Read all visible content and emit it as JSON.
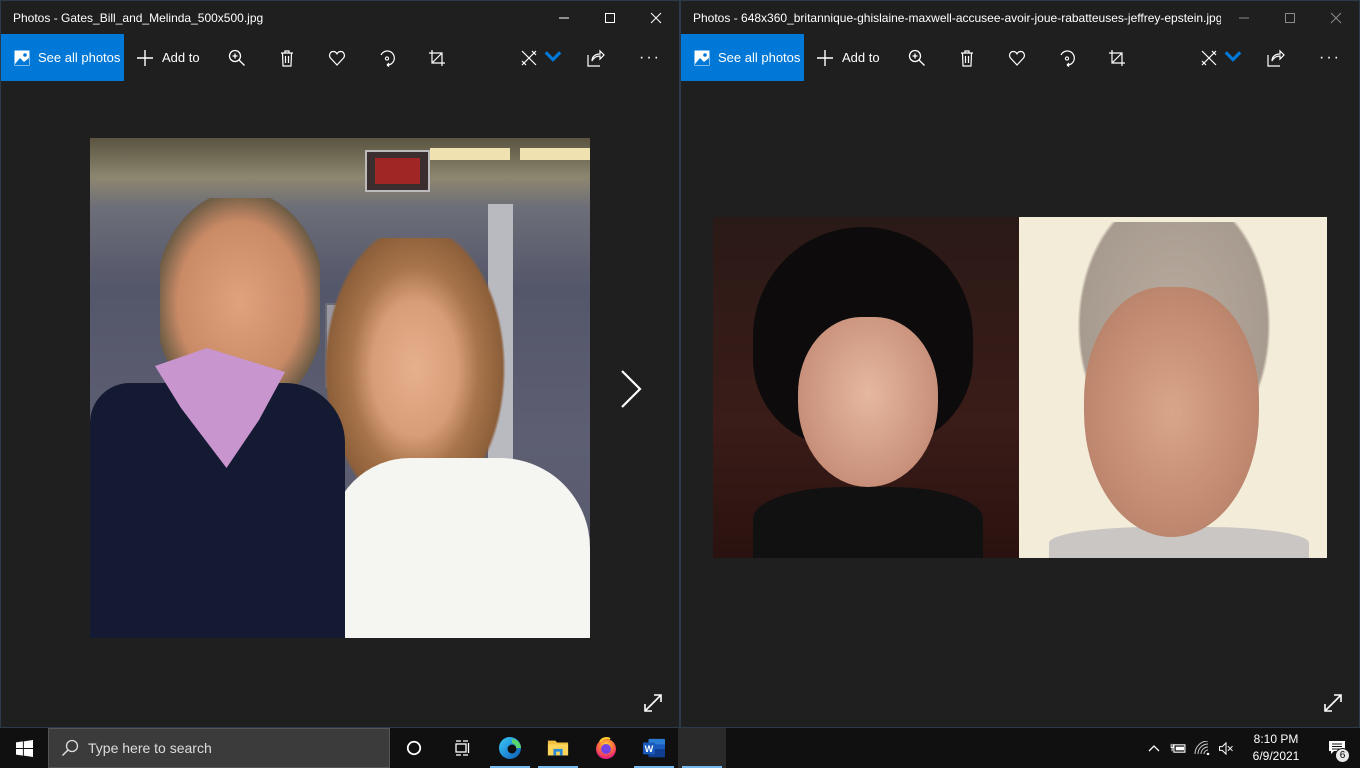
{
  "windows": [
    {
      "title": "Photos - Gates_Bill_and_Melinda_500x500.jpg",
      "image_description": "Bill and Melinda Gates smiling, indoors",
      "toolbar": {
        "see_all_label": "See all photos",
        "add_to_label": "Add to",
        "icons": [
          "zoom-in-icon",
          "delete-icon",
          "favorite-icon",
          "rotate-icon",
          "crop-icon",
          "edit-icon",
          "share-icon",
          "more-icon"
        ],
        "more_label": "···"
      },
      "controls": {
        "minimize": "minimize",
        "maximize": "maximize",
        "close": "close"
      }
    },
    {
      "title": "Photos - 648x360_britannique-ghislaine-maxwell-accusee-avoir-joue-rabatteuses-jeffrey-epstein.jpg",
      "image_description": "Side-by-side portraits of Ghislaine Maxwell and Jeffrey Epstein",
      "toolbar": {
        "see_all_label": "See all photos",
        "add_to_label": "Add to",
        "icons": [
          "zoom-in-icon",
          "delete-icon",
          "favorite-icon",
          "rotate-icon",
          "crop-icon",
          "edit-icon",
          "share-icon",
          "more-icon"
        ],
        "more_label": "···"
      },
      "controls": {
        "minimize": "minimize",
        "maximize": "maximize",
        "close": "close"
      }
    }
  ],
  "taskbar": {
    "search_placeholder": "Type here to search",
    "pinned": [
      "Cortana",
      "Task View",
      "Microsoft Edge",
      "File Explorer",
      "Firefox",
      "Microsoft Word",
      "Photos"
    ],
    "clock": {
      "time": "8:10 PM",
      "date": "6/9/2021"
    },
    "notification_count": "6"
  },
  "colors": {
    "accent": "#0078d7",
    "background": "#1f1f1f",
    "taskbar": "#101010"
  }
}
